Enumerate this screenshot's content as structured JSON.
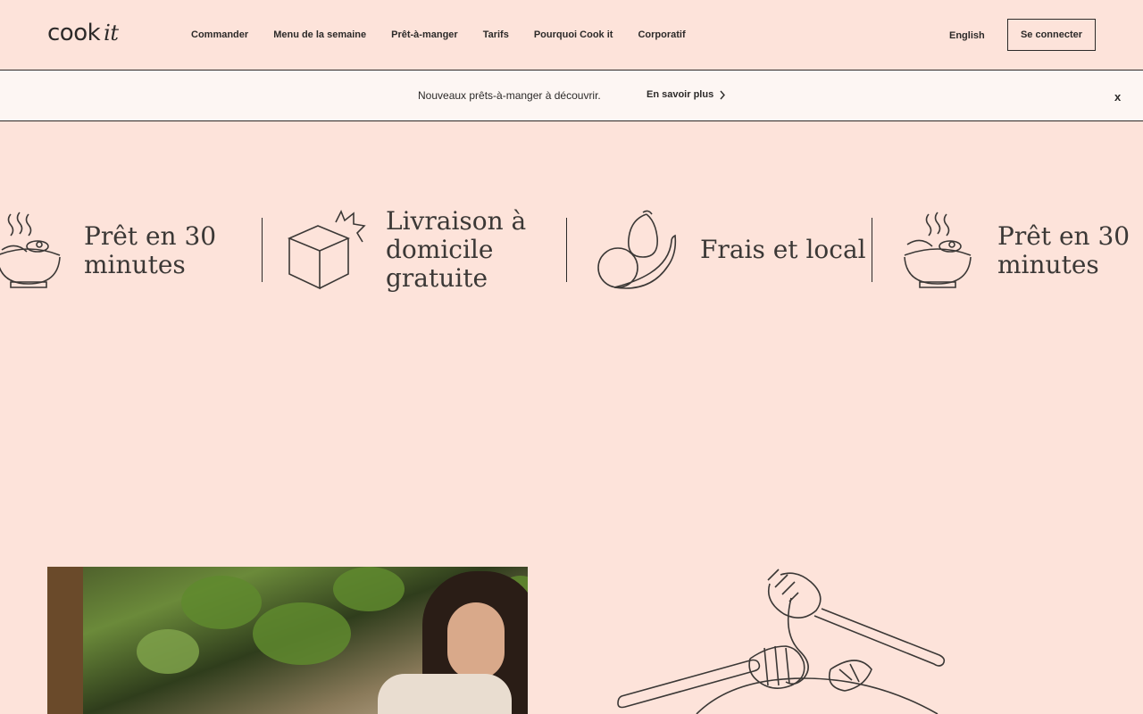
{
  "header": {
    "logo_main": "cook",
    "logo_suffix": "it",
    "nav": [
      "Commander",
      "Menu de la semaine",
      "Prêt-à-manger",
      "Tarifs",
      "Pourquoi Cook it",
      "Corporatif"
    ],
    "language": "English",
    "login": "Se connecter"
  },
  "banner": {
    "message": "Nouveaux prêts-à-manger à découvrir.",
    "link": "En savoir plus",
    "close": "x"
  },
  "features": [
    {
      "line1": "Prêt en 30",
      "line2": "minutes",
      "icon": "bowl-icon"
    },
    {
      "line1": "Livraison à",
      "line2": "domicile",
      "line3": "gratuite",
      "icon": "box-icon"
    },
    {
      "line1": "Frais et local",
      "icon": "produce-icon"
    },
    {
      "line1": "Prêt en 30",
      "line2": "minutes",
      "icon": "bowl-icon"
    }
  ],
  "colors": {
    "background": "#fde3da",
    "banner": "#fdf6f3",
    "ink": "#2c2a29"
  }
}
